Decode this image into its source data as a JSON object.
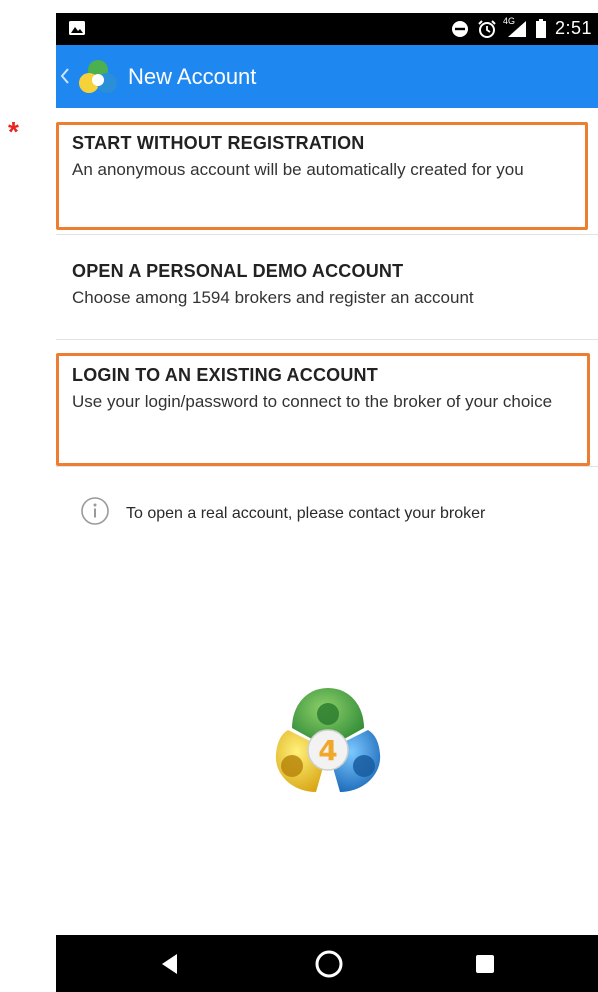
{
  "status_bar": {
    "time": "2:51",
    "network_label": "4G",
    "icons": [
      "image-icon",
      "do-not-disturb-icon",
      "alarm-icon",
      "signal-icon",
      "battery-icon"
    ]
  },
  "app_bar": {
    "title": "New Account",
    "back_icon": "chevron-left-icon",
    "logo_icon": "metatrader-logo-icon",
    "color": "#1e88f0"
  },
  "marker": {
    "symbol": "*",
    "color": "#e8261f"
  },
  "options": [
    {
      "title": "START WITHOUT REGISTRATION",
      "description": "An anonymous account will be automatically created for you"
    },
    {
      "title": "OPEN A PERSONAL DEMO ACCOUNT",
      "description": "Choose among 1594 brokers and register an account"
    },
    {
      "title": "LOGIN TO AN EXISTING ACCOUNT",
      "description": "Use your login/password to connect to the broker of your choice"
    }
  ],
  "info": {
    "icon": "info-icon",
    "text": "To open a real account, please contact your broker"
  },
  "logo_badge": "4",
  "nav_bar": {
    "icons": [
      "back-triangle-icon",
      "home-circle-icon",
      "recents-square-icon"
    ]
  },
  "highlight_color": "#ed7d31"
}
